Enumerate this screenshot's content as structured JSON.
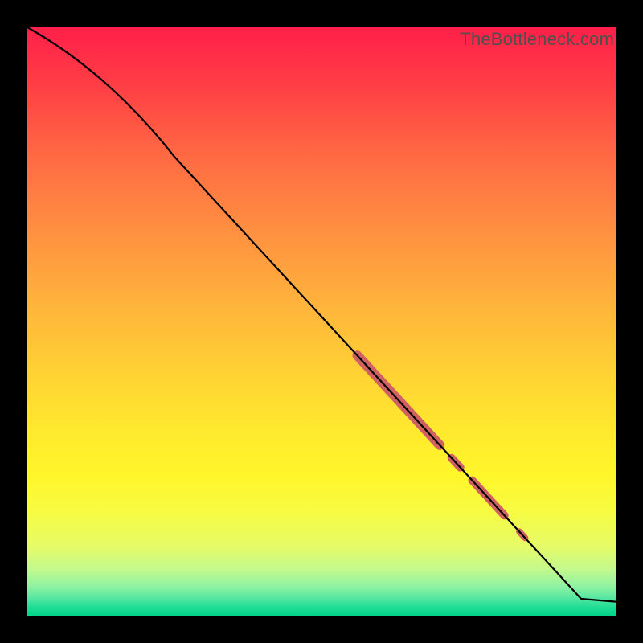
{
  "watermark": "TheBottleneck.com",
  "chart_data": {
    "type": "line",
    "title": "",
    "xlabel": "",
    "ylabel": "",
    "xlim": [
      0,
      1
    ],
    "ylim": [
      0,
      1
    ],
    "series": [
      {
        "name": "curve",
        "points": [
          {
            "x": 0.0,
            "y": 1.0
          },
          {
            "x": 0.25,
            "y": 0.78
          },
          {
            "x": 0.94,
            "y": 0.03
          },
          {
            "x": 1.0,
            "y": 0.025
          }
        ]
      }
    ],
    "highlights": [
      {
        "name": "segment-a",
        "x0": 0.56,
        "x1": 0.7,
        "thickness": 12
      },
      {
        "name": "dot-a",
        "x0": 0.72,
        "x1": 0.735,
        "thickness": 10
      },
      {
        "name": "segment-b",
        "x0": 0.755,
        "x1": 0.81,
        "thickness": 10
      },
      {
        "name": "dot-b",
        "x0": 0.835,
        "x1": 0.845,
        "thickness": 8
      }
    ],
    "gradient_stops": [
      {
        "position": 1.0,
        "color": "#ff1f49"
      },
      {
        "position": 0.5,
        "color": "#ffd034"
      },
      {
        "position": 0.2,
        "color": "#fff62a"
      },
      {
        "position": 0.0,
        "color": "#00d48a"
      }
    ]
  }
}
